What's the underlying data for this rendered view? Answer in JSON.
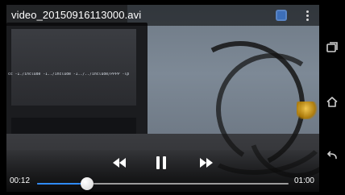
{
  "app": {
    "title": "video_20150916113000.avi"
  },
  "video_overlay": {
    "command_text": "cc -I./include -I../include -I../../include/PPPP -lpth"
  },
  "player": {
    "time_elapsed": "00:12",
    "time_total": "01:00",
    "progress_fraction": 0.2
  },
  "icons": {
    "top_search": "search-icon",
    "top_more": "overflow-menu-icon",
    "rewind": "rewind-icon",
    "pause": "pause-icon",
    "forward": "fast-forward-icon",
    "nav_recents": "recent-apps-icon",
    "nav_home": "home-icon",
    "nav_back": "back-icon"
  },
  "colors": {
    "accent": "#2f8bff",
    "icon": "#ffffff"
  }
}
